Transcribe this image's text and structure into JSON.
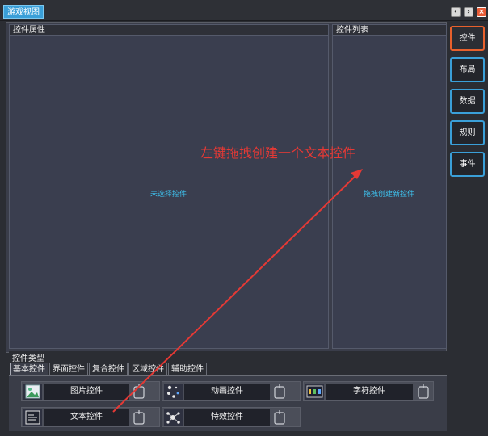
{
  "window": {
    "title": "游戏视图"
  },
  "panels": {
    "properties": {
      "title": "控件属性",
      "empty_hint": "未选择控件"
    },
    "list": {
      "title": "控件列表",
      "empty_hint": "拖拽创建新控件"
    }
  },
  "sidebar": {
    "buttons": [
      {
        "label": "控件",
        "active": true
      },
      {
        "label": "布局",
        "active": false
      },
      {
        "label": "数据",
        "active": false
      },
      {
        "label": "规则",
        "active": false
      },
      {
        "label": "事件",
        "active": false
      }
    ]
  },
  "annotation": {
    "text": "左键拖拽创建一个文本控件",
    "color": "#e53935"
  },
  "control_types": {
    "title": "控件类型",
    "tabs": [
      "基本控件",
      "界面控件",
      "复合控件",
      "区域控件",
      "辅助控件"
    ],
    "active_tab": "基本控件",
    "items": [
      {
        "label": "图片控件",
        "icon": "image-icon"
      },
      {
        "label": "动画控件",
        "icon": "animation-dots-icon"
      },
      {
        "label": "字符控件",
        "icon": "digits-123-icon"
      },
      {
        "label": "文本控件",
        "icon": "text-lines-icon"
      },
      {
        "label": "特效控件",
        "icon": "particle-effect-icon"
      }
    ]
  },
  "colors": {
    "accent": "#3a9fd8",
    "active_border": "#e8602c",
    "hint_text": "#3ec0ec"
  }
}
